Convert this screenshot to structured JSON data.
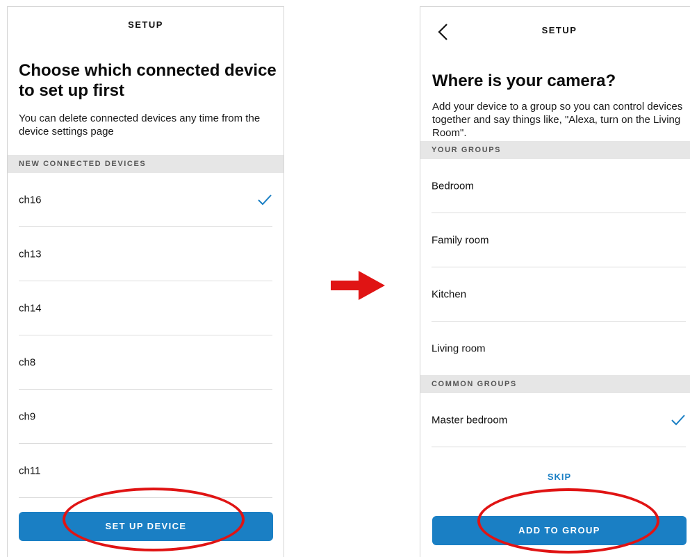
{
  "left_screen": {
    "header_title": "SETUP",
    "heading": "Choose which connected device to set up first",
    "description": "You can delete connected devices any time from the device settings page",
    "section_header": "NEW CONNECTED DEVICES",
    "devices": [
      {
        "label": "ch16",
        "selected": true
      },
      {
        "label": "ch13",
        "selected": false
      },
      {
        "label": "ch14",
        "selected": false
      },
      {
        "label": "ch8",
        "selected": false
      },
      {
        "label": "ch9",
        "selected": false
      },
      {
        "label": "ch11",
        "selected": false
      }
    ],
    "button_label": "SET UP DEVICE"
  },
  "right_screen": {
    "header_title": "SETUP",
    "heading": "Where is your camera?",
    "description": "Add your device to a group so you can control devices together and say things like, \"Alexa, turn on the Living Room\".",
    "your_groups_header": "YOUR GROUPS",
    "your_groups": [
      {
        "label": "Bedroom"
      },
      {
        "label": "Family room"
      },
      {
        "label": "Kitchen"
      },
      {
        "label": "Living room"
      }
    ],
    "common_groups_header": "COMMON GROUPS",
    "common_groups": [
      {
        "label": "Master bedroom",
        "selected": true
      }
    ],
    "skip_label": "SKIP",
    "button_label": "ADD TO GROUP"
  },
  "colors": {
    "accent": "#1a7fc4",
    "highlight": "#e01414",
    "section_bg": "#e6e6e6"
  }
}
